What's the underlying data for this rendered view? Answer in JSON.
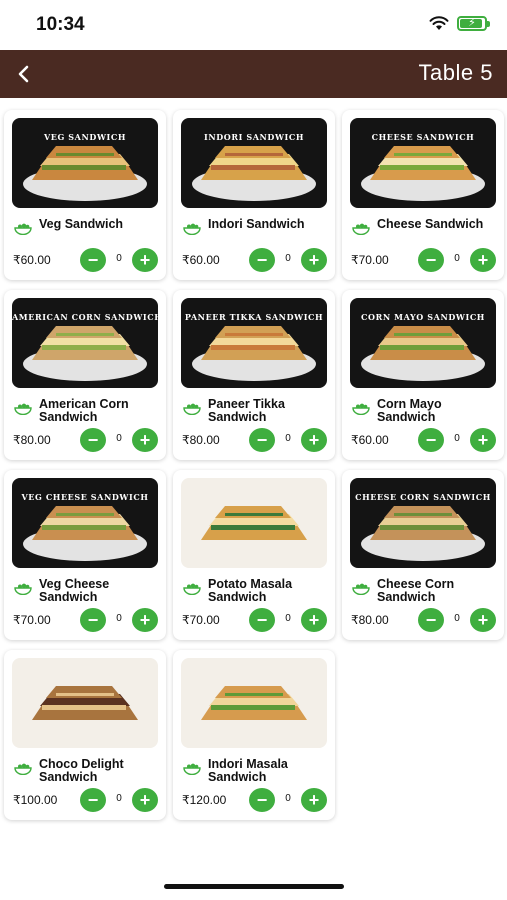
{
  "status_bar": {
    "time": "10:34",
    "icons": [
      "wifi-icon",
      "battery-charging-icon"
    ],
    "battery_color": "#3fae3f"
  },
  "header": {
    "title": "Table 5",
    "back_icon": "chevron-left-icon",
    "background": "#4a2a22"
  },
  "accent_color": "#3fae3f",
  "menu": {
    "items": [
      {
        "name": "Veg Sandwich",
        "price": "₹60.00",
        "qty": "0",
        "image_label": "VEG SANDWICH"
      },
      {
        "name": "Indori Sandwich",
        "price": "₹60.00",
        "qty": "0",
        "image_label": "INDORI SANDWICH"
      },
      {
        "name": "Cheese Sandwich",
        "price": "₹70.00",
        "qty": "0",
        "image_label": "CHEESE SANDWICH"
      },
      {
        "name": "American Corn Sandwich",
        "price": "₹80.00",
        "qty": "0",
        "image_label": "AMERICAN CORN SANDWICH"
      },
      {
        "name": "Paneer Tikka Sandwich",
        "price": "₹80.00",
        "qty": "0",
        "image_label": "PANEER TIKKA SANDWICH"
      },
      {
        "name": "Corn Mayo Sandwich",
        "price": "₹60.00",
        "qty": "0",
        "image_label": "CORN MAYO SANDWICH"
      },
      {
        "name": "Veg Cheese Sandwich",
        "price": "₹70.00",
        "qty": "0",
        "image_label": "VEG CHEESE SANDWICH"
      },
      {
        "name": "Potato Masala Sandwich",
        "price": "₹70.00",
        "qty": "0",
        "image_label": ""
      },
      {
        "name": "Cheese Corn Sandwich",
        "price": "₹80.00",
        "qty": "0",
        "image_label": "CHEESE CORN SANDWICH"
      },
      {
        "name": "Choco Delight Sandwich",
        "price": "₹100.00",
        "qty": "0",
        "image_label": ""
      },
      {
        "name": "Indori Masala Sandwich",
        "price": "₹120.00",
        "qty": "0",
        "image_label": ""
      }
    ]
  }
}
